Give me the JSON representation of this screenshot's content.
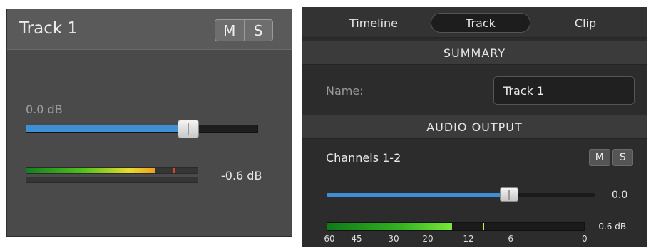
{
  "left_panel": {
    "title": "Track 1",
    "mute_label": "M",
    "solo_label": "S",
    "fader": {
      "readout": "0.0 dB",
      "level": 0.7
    },
    "meter": {
      "level": 0.75,
      "peak": 0.86,
      "label": "-0.6 dB"
    }
  },
  "right_panel": {
    "tabs": [
      {
        "label": "Timeline",
        "active": false
      },
      {
        "label": "Track",
        "active": true
      },
      {
        "label": "Clip",
        "active": false
      }
    ],
    "summary": {
      "header": "SUMMARY",
      "name_label": "Name:",
      "name_value": "Track 1"
    },
    "audio_output": {
      "header": "AUDIO OUTPUT",
      "channels_label": "Channels 1-2",
      "mute_label": "M",
      "solo_label": "S",
      "fader_value": "0.0",
      "fader_level": 0.68,
      "meter_label": "-0.6 dB",
      "meter_level": 0.485,
      "meter_peak": 0.605,
      "scale_ticks": [
        "-60",
        "-45",
        "-30",
        "-20",
        "-12",
        "-6",
        "0"
      ]
    }
  },
  "colors": {
    "accent_blue": "#3e8fd4",
    "panel_dark": "#2c2c2c",
    "panel_mid": "#4a4a4a"
  }
}
